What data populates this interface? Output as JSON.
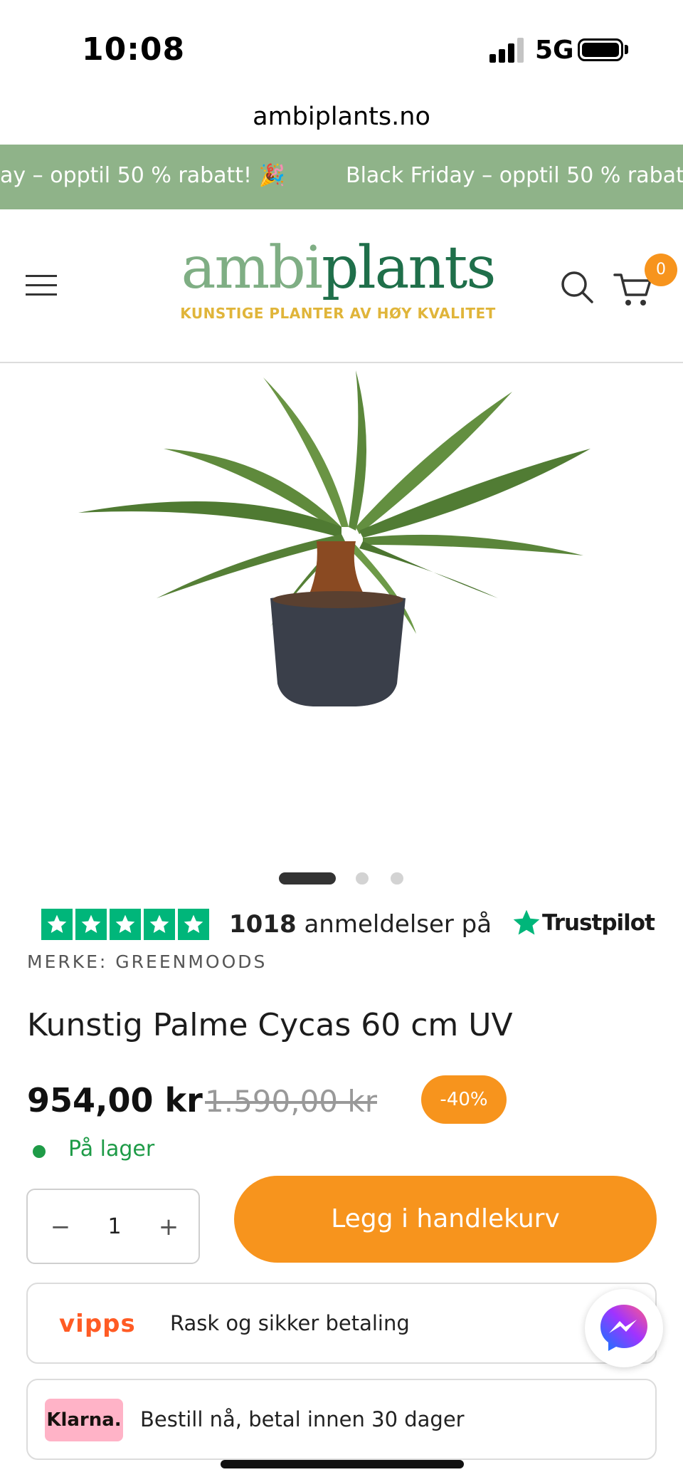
{
  "status_bar": {
    "time": "10:08",
    "network": "5G"
  },
  "browser": {
    "url": "ambiplants.no"
  },
  "promo": {
    "text_left": "ay – opptil 50 % rabatt! 🎉",
    "text_right": "Black Friday – opptil 50 % rabatt"
  },
  "header": {
    "logo_part1": "ambi",
    "logo_part2": "plants",
    "tagline": "KUNSTIGE PLANTER AV HØY KVALITET",
    "cart_count": "0"
  },
  "carousel": {
    "slides": 3,
    "active": 1
  },
  "trustpilot": {
    "count": "1018",
    "text": " anmeldelser på",
    "brand": "Trustpilot",
    "stars": 5
  },
  "product": {
    "brand": "MERKE: GREENMOODS",
    "title": "Kunstig Palme Cycas 60 cm UV",
    "price": "954,00 kr",
    "old_price": "1.590,00 kr",
    "discount": "-40%",
    "stock": "På lager",
    "quantity": "1",
    "add_to_cart": "Legg i handlekurv"
  },
  "payments": {
    "vipps_logo": "vipps",
    "vipps_text": "Rask og sikker betaling",
    "klarna_logo": "Klarna.",
    "klarna_text": "Bestill nå, betal innen 30 dager"
  },
  "colors": {
    "accent": "#f7941d",
    "promo": "#8fb389",
    "brand_green": "#1f6f4a",
    "stock_green": "#1e9b47"
  }
}
